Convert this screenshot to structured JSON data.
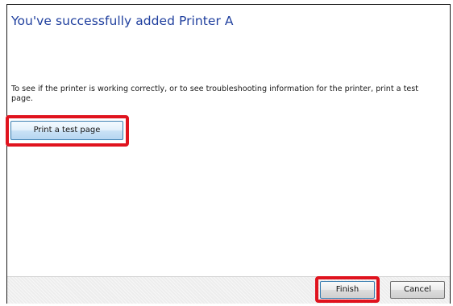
{
  "dialog": {
    "title": "You've successfully added Printer A",
    "description": "To see if the printer is working correctly, or to see troubleshooting information for the printer, print a test page.",
    "print_test_page_label": "Print a test page"
  },
  "footer": {
    "finish_label": "Finish",
    "cancel_label": "Cancel"
  },
  "colors": {
    "title": "#1f3f9e",
    "highlight": "#e0131e"
  }
}
